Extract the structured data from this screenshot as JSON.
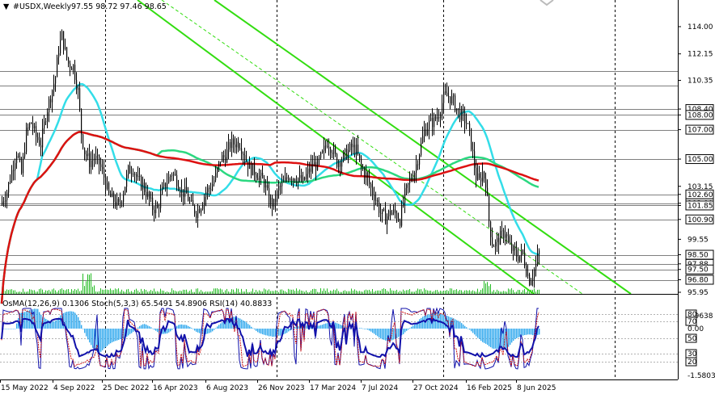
{
  "header": {
    "arrow": "▼",
    "symbol": "#USDX,Weekly",
    "ohlc": "97.55 98.72 97.46 98.65"
  },
  "indicator_header": "OsMA(12,26,9) 0.1306  Stoch(5,3,3) 65.5491 54.8906  RSI(14) 40.8833",
  "colors": {
    "candles": "#000000",
    "grid": "#000000",
    "ma_fast": "#33dde8",
    "ma_mid": "#2bd880",
    "ma_slow": "#dd1111",
    "channel": "#33dd11",
    "volume": "#22bb22",
    "osma": "#33aaee",
    "stoch_main": "#1111aa",
    "stoch_signal": "#cc1111",
    "rsi": "#9900cc"
  },
  "chart_data": [
    {
      "type": "candlestick",
      "title": "#USDX,Weekly",
      "ylim": [
        95.2,
        115.2
      ],
      "price_ticks": [
        "114.00",
        "112.15",
        "110.35",
        "108.40",
        "108.00",
        "107.00",
        "105.00",
        "103.15",
        "102.60",
        "102.00",
        "101.85",
        "100.90",
        "99.55",
        "98.50",
        "97.88",
        "97.50",
        "96.80",
        "95.95"
      ],
      "price_lines": [
        "111.00",
        "110.00",
        "108.40",
        "108.00",
        "107.00",
        "105.00",
        "102.60",
        "102.00",
        "101.85",
        "100.90",
        "98.50",
        "97.88",
        "97.50",
        "96.80"
      ],
      "highlighted_levels": [
        "111.00",
        "110.00",
        "108.40",
        "108.00",
        "107.00",
        "105.00",
        "102.60",
        "102.00",
        "101.85",
        "100.90",
        "98.50",
        "97.88",
        "97.50",
        "96.80"
      ],
      "x_labels": [
        "15 May 2022",
        "4 Sep 2022",
        "25 Dec 2022",
        "16 Apr 2023",
        "6 Aug 2023",
        "26 Nov 2023",
        "17 Mar 2024",
        "7 Jul 2024",
        "27 Oct 2024",
        "16 Feb 2025",
        "8 Jun 2025"
      ],
      "close_path": [
        [
          0,
          101.9
        ],
        [
          8,
          102.8
        ],
        [
          14,
          104.2
        ],
        [
          20,
          105.5
        ],
        [
          26,
          104.0
        ],
        [
          32,
          106.8
        ],
        [
          38,
          107.5
        ],
        [
          44,
          106.5
        ],
        [
          50,
          106.0
        ],
        [
          56,
          108.0
        ],
        [
          62,
          109.3
        ],
        [
          68,
          110.6
        ],
        [
          72,
          112.5
        ],
        [
          76,
          113.4
        ],
        [
          80,
          112.3
        ],
        [
          84,
          111.5
        ],
        [
          90,
          111.3
        ],
        [
          96,
          109.6
        ],
        [
          100,
          106.8
        ],
        [
          104,
          105.5
        ],
        [
          110,
          104.8
        ],
        [
          116,
          105.1
        ],
        [
          122,
          104.7
        ],
        [
          128,
          103.8
        ],
        [
          134,
          102.5
        ],
        [
          140,
          102.2
        ],
        [
          146,
          101.8
        ],
        [
          152,
          102.8
        ],
        [
          158,
          104.2
        ],
        [
          164,
          104.4
        ],
        [
          170,
          103.5
        ],
        [
          176,
          103.2
        ],
        [
          182,
          102.5
        ],
        [
          188,
          101.7
        ],
        [
          194,
          101.6
        ],
        [
          200,
          102.8
        ],
        [
          206,
          103.5
        ],
        [
          212,
          104.1
        ],
        [
          218,
          103.6
        ],
        [
          224,
          102.8
        ],
        [
          230,
          102.6
        ],
        [
          236,
          101.8
        ],
        [
          242,
          101.4
        ],
        [
          248,
          101.9
        ],
        [
          254,
          102.8
        ],
        [
          260,
          103.1
        ],
        [
          266,
          103.8
        ],
        [
          272,
          105.0
        ],
        [
          278,
          105.2
        ],
        [
          284,
          106.0
        ],
        [
          290,
          106.1
        ],
        [
          296,
          106.1
        ],
        [
          302,
          105.2
        ],
        [
          308,
          104.4
        ],
        [
          314,
          104.2
        ],
        [
          320,
          103.8
        ],
        [
          326,
          103.4
        ],
        [
          332,
          102.2
        ],
        [
          338,
          101.9
        ],
        [
          344,
          103.0
        ],
        [
          350,
          103.3
        ],
        [
          356,
          103.9
        ],
        [
          362,
          103.8
        ],
        [
          368,
          103.7
        ],
        [
          374,
          103.4
        ],
        [
          380,
          104.1
        ],
        [
          386,
          104.6
        ],
        [
          392,
          104.6
        ],
        [
          398,
          105.3
        ],
        [
          404,
          106.2
        ],
        [
          410,
          105.7
        ],
        [
          416,
          104.8
        ],
        [
          422,
          105.0
        ],
        [
          428,
          105.4
        ],
        [
          434,
          105.8
        ],
        [
          440,
          105.6
        ],
        [
          446,
          104.4
        ],
        [
          452,
          103.9
        ],
        [
          458,
          103.0
        ],
        [
          464,
          102.3
        ],
        [
          470,
          101.3
        ],
        [
          476,
          101.0
        ],
        [
          482,
          101.4
        ],
        [
          488,
          101.3
        ],
        [
          494,
          100.9
        ],
        [
          500,
          102.6
        ],
        [
          506,
          103.5
        ],
        [
          512,
          104.2
        ],
        [
          518,
          105.5
        ],
        [
          524,
          106.9
        ],
        [
          530,
          107.4
        ],
        [
          536,
          107.6
        ],
        [
          542,
          108.1
        ],
        [
          548,
          109.2
        ],
        [
          554,
          109.3
        ],
        [
          560,
          108.9
        ],
        [
          566,
          108.2
        ],
        [
          572,
          107.8
        ],
        [
          576,
          107.5
        ],
        [
          580,
          106.7
        ],
        [
          584,
          105.3
        ],
        [
          588,
          103.8
        ],
        [
          592,
          103.5
        ],
        [
          596,
          104.1
        ],
        [
          600,
          103.5
        ],
        [
          604,
          100.8
        ],
        [
          608,
          99.3
        ],
        [
          612,
          99.2
        ],
        [
          618,
          99.7
        ],
        [
          624,
          100.1
        ],
        [
          628,
          99.2
        ],
        [
          634,
          98.7
        ],
        [
          640,
          98.4
        ],
        [
          646,
          98.6
        ],
        [
          650,
          97.5
        ],
        [
          654,
          96.8
        ],
        [
          658,
          97.2
        ],
        [
          662,
          97.8
        ],
        [
          666,
          98.65
        ]
      ],
      "volume_hint": "weekly volume histogram at panel bottom"
    },
    {
      "type": "line",
      "title": "OsMA(12,26,9) 0.1306  Stoch(5,3,3) 65.5491 54.8906  RSI(14) 40.8833",
      "ylim": [
        -1.5803,
        0.9638
      ],
      "y_ticks": [
        "0.9638",
        "80",
        "70",
        "50",
        "0.00",
        "30",
        "20",
        "-1.5803"
      ],
      "levels": [
        80,
        70,
        50,
        30,
        20
      ]
    }
  ]
}
